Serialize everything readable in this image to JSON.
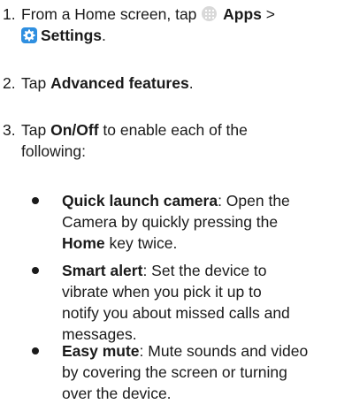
{
  "steps": [
    {
      "number": "1.",
      "line1_pre": "From a Home screen, tap",
      "apps_label": "Apps",
      "arrow": ">",
      "settings_label": "Settings",
      "period": "."
    },
    {
      "number": "2.",
      "pre": "Tap",
      "bold": "Advanced features",
      "post": "."
    },
    {
      "number": "3.",
      "pre": "Tap",
      "bold": "On/Off",
      "line1_post": "to enable each of the",
      "line2": "following:"
    }
  ],
  "bullets": [
    {
      "term": "Quick launch camera",
      "line1_rest": ": Open the",
      "line2": "Camera by quickly pressing the",
      "line3_bold": "Home",
      "line3_rest": " key twice."
    },
    {
      "term": "Smart alert",
      "line1_rest": ": Set the device to",
      "line2": "vibrate when you pick it up to",
      "line3": "notify you about missed calls and",
      "line4": "messages."
    },
    {
      "term": "Easy mute",
      "line1_rest": ": Mute sounds and video",
      "line2": "by covering the screen or turning",
      "line3": "over the device."
    }
  ],
  "icons": {
    "apps": "apps-grid-icon",
    "settings": "settings-gear-icon"
  },
  "colors": {
    "text": "#1a1a1a",
    "settings_icon_bg": "#2f8fe0",
    "apps_icon_bg": "#d9d9d9"
  }
}
